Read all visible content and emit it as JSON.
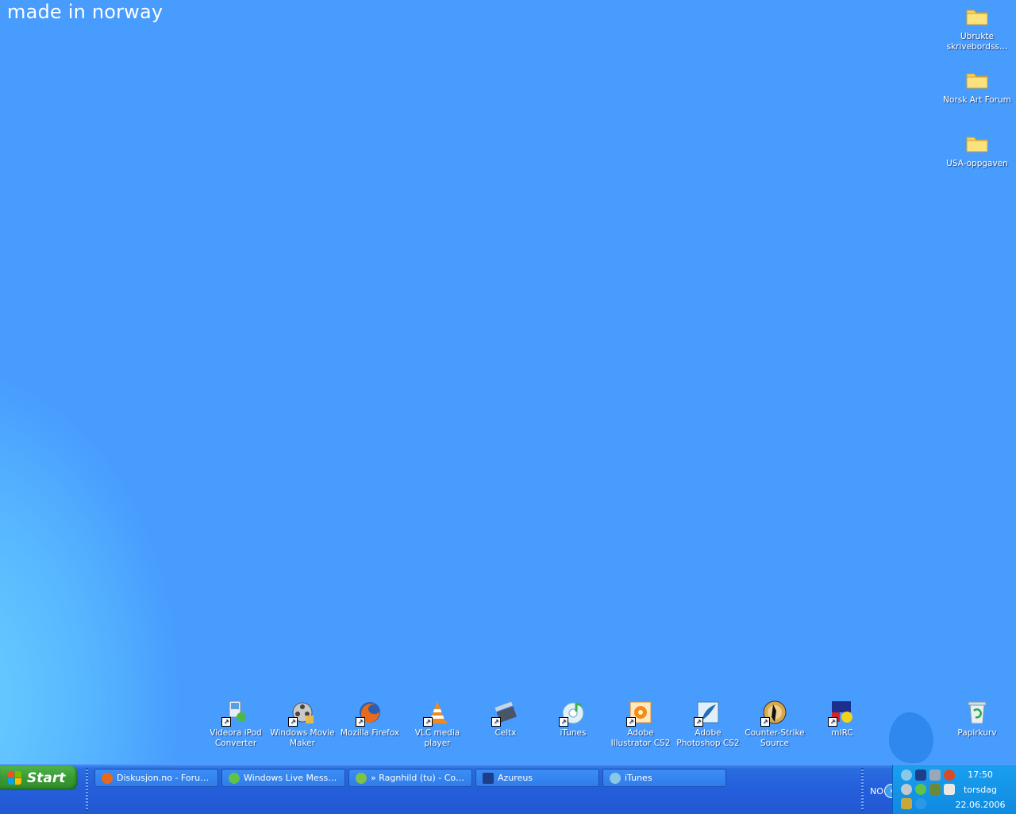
{
  "wallpaper": {
    "text": "made in norway"
  },
  "desktop_icons_right": [
    {
      "label": "Ubrukte skrivebordss…",
      "icon": "folder-icon"
    },
    {
      "label": "Norsk Art Forum",
      "icon": "folder-icon"
    },
    {
      "label": "USA-oppgaven",
      "icon": "folder-icon"
    }
  ],
  "desktop_icons_bottom": [
    {
      "label": "Videora iPod Converter",
      "icon": "ipod-converter-icon"
    },
    {
      "label": "Windows Movie Maker",
      "icon": "movie-maker-icon"
    },
    {
      "label": "Mozilla Firefox",
      "icon": "firefox-icon"
    },
    {
      "label": "VLC media player",
      "icon": "vlc-icon"
    },
    {
      "label": "Celtx",
      "icon": "celtx-icon"
    },
    {
      "label": "iTunes",
      "icon": "itunes-icon"
    },
    {
      "label": "Adobe Illustrator CS2",
      "icon": "illustrator-icon"
    },
    {
      "label": "Adobe Photoshop CS2",
      "icon": "photoshop-icon"
    },
    {
      "label": "Counter-Strike Source",
      "icon": "counter-strike-icon"
    },
    {
      "label": "mIRC",
      "icon": "mirc-icon"
    },
    {
      "label": "Papirkurv",
      "icon": "recycle-bin-icon"
    }
  ],
  "taskbar": {
    "start_label": "Start",
    "buttons": [
      {
        "label": "Diskusjon.no - Forum …",
        "icon": "firefox-icon",
        "color": "#e66a1a"
      },
      {
        "label": "Windows Live Messen…",
        "icon": "messenger-icon",
        "color": "#5fc24a"
      },
      {
        "label": "» Ragnhild (tu) - Con…",
        "icon": "messenger-chat-icon",
        "color": "#7dc24a"
      },
      {
        "label": "Azureus",
        "icon": "azureus-icon",
        "color": "#1d3e8a"
      },
      {
        "label": "iTunes",
        "icon": "itunes-icon",
        "color": "#8ac8e8"
      }
    ]
  },
  "tray": {
    "language": "NO",
    "time": "17:50",
    "day": "torsdag",
    "date": "22.06.2006"
  }
}
